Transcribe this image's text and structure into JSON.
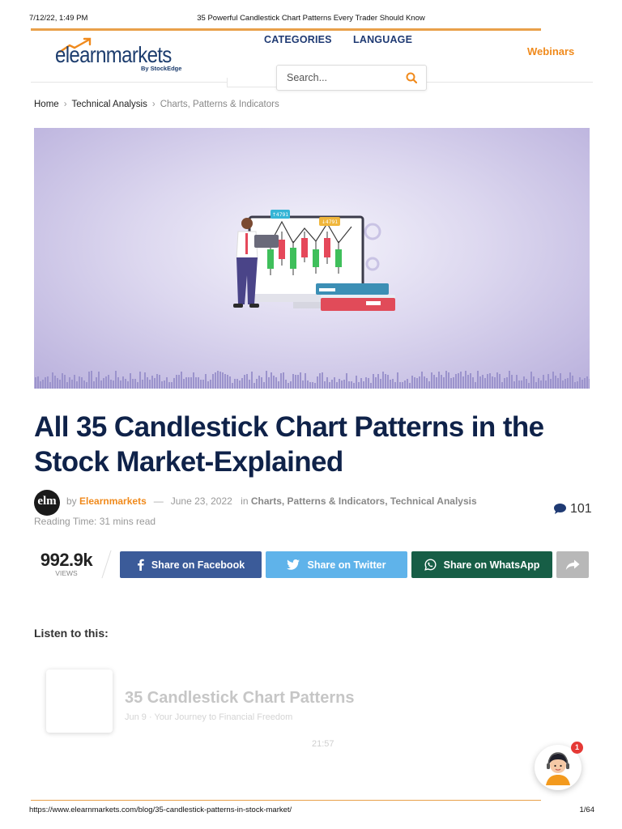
{
  "print_header": {
    "date": "7/12/22, 1:49 PM",
    "title": "35 Powerful Candlestick Chart Patterns Every Trader Should Know"
  },
  "logo": {
    "brand": "elearnmarkets",
    "tagline": "By StockEdge"
  },
  "nav": {
    "categories": "CATEGORIES",
    "language": "LANGUAGE",
    "webinars": "Webinars"
  },
  "search": {
    "placeholder": "Search..."
  },
  "breadcrumb": {
    "home": "Home",
    "section": "Technical Analysis",
    "current": "Charts, Patterns & Indicators"
  },
  "hero": {
    "price_tag_1": "↑4791",
    "price_tag_2": "↓4791"
  },
  "article": {
    "title": "All 35 Candlestick Chart Patterns in the Stock Market-Explained",
    "avatar_text": "elm",
    "by": "by",
    "author": "Elearnmarkets",
    "dash": "—",
    "date": "June 23, 2022",
    "in": "in",
    "category_1": "Charts, Patterns & Indicators",
    "category_sep": ",",
    "category_2": "Technical Analysis",
    "reading_time": "Reading Time: 31 mins read",
    "comments": "101"
  },
  "views": {
    "count": "992.9k",
    "label": "VIEWS"
  },
  "share": {
    "facebook": "Share on Facebook",
    "twitter": "Share on Twitter",
    "whatsapp": "Share on WhatsApp"
  },
  "listen": {
    "heading": "Listen to this:",
    "title": "35 Candlestick Chart Patterns",
    "subtitle": "Jun 9 · Your Journey to Financial Freedom",
    "duration": "21:57"
  },
  "chat": {
    "badge": "1"
  },
  "print_footer": {
    "url": "https://www.elearnmarkets.com/blog/35-candlestick-patterns-in-stock-market/",
    "page": "1/64"
  },
  "colors": {
    "brand_navy": "#0f2249",
    "accent_orange": "#f08a1c",
    "facebook": "#3b5b99",
    "twitter": "#5fb3ea",
    "whatsapp": "#175e46"
  }
}
